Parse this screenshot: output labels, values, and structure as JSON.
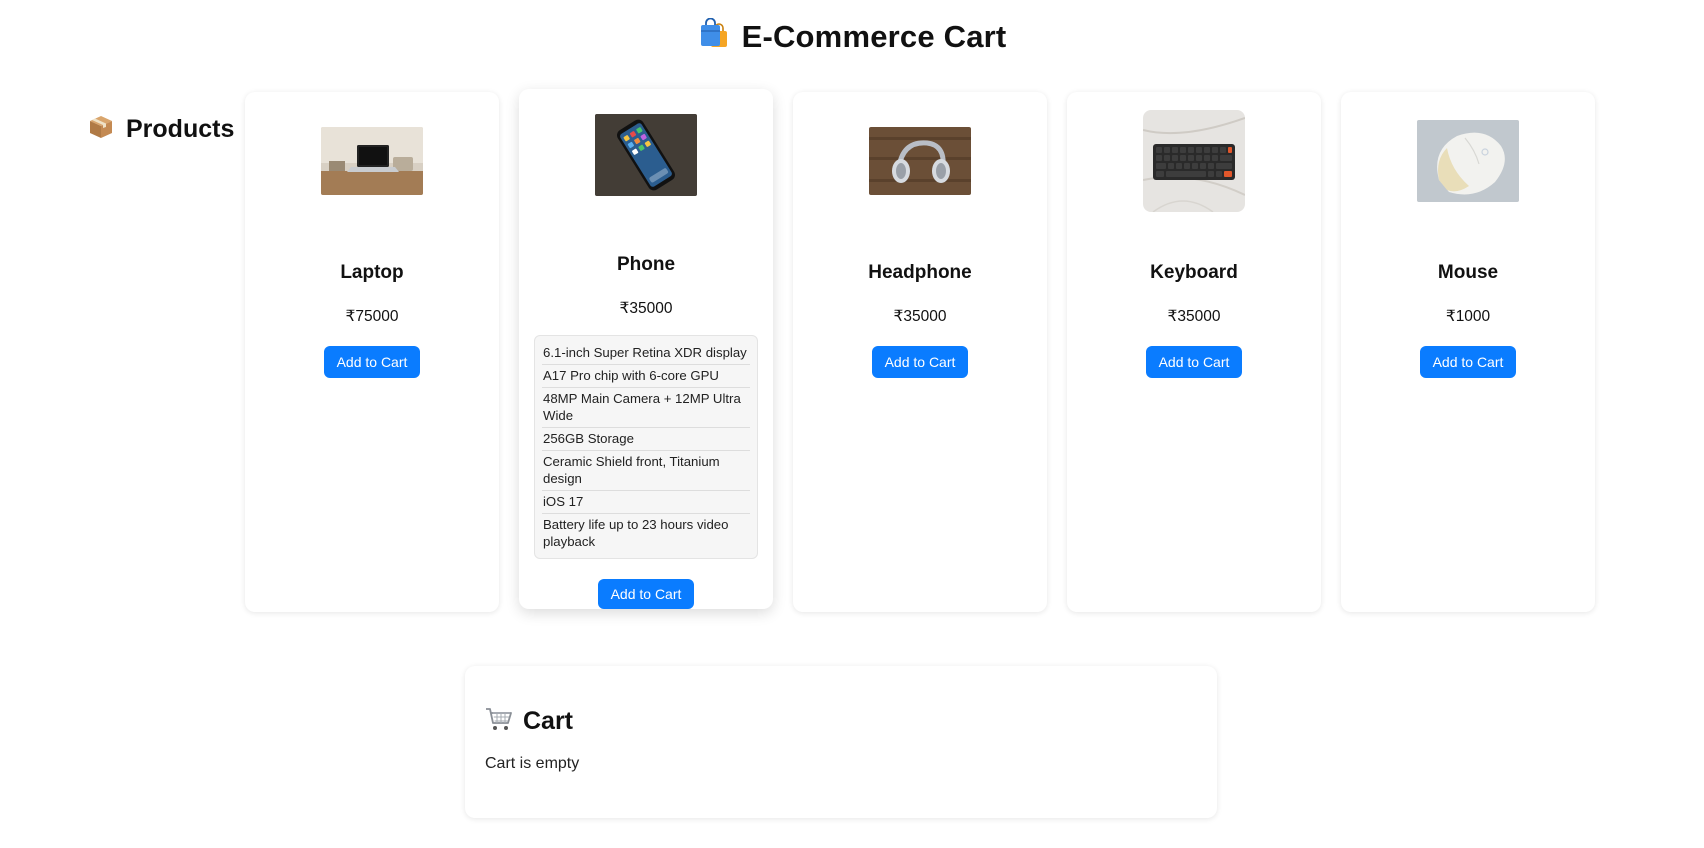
{
  "header": {
    "title": "E-Commerce Cart",
    "icon": "shopping-bags-icon"
  },
  "products_section": {
    "title": "Products",
    "icon": "package-icon"
  },
  "products": [
    {
      "name": "Laptop",
      "price": "₹75000",
      "button": "Add to Cart",
      "image": "laptop-photo",
      "specs": []
    },
    {
      "name": "Phone",
      "price": "₹35000",
      "button": "Add to Cart",
      "image": "phone-photo",
      "specs": [
        "6.1-inch Super Retina XDR display",
        "A17 Pro chip with 6-core GPU",
        "48MP Main Camera + 12MP Ultra Wide",
        "256GB Storage",
        "Ceramic Shield front, Titanium design",
        "iOS 17",
        "Battery life up to 23 hours video playback"
      ]
    },
    {
      "name": "Headphone",
      "price": "₹35000",
      "button": "Add to Cart",
      "image": "headphone-photo",
      "specs": []
    },
    {
      "name": "Keyboard",
      "price": "₹35000",
      "button": "Add to Cart",
      "image": "keyboard-photo",
      "specs": []
    },
    {
      "name": "Mouse",
      "price": "₹1000",
      "button": "Add to Cart",
      "image": "mouse-photo",
      "specs": []
    }
  ],
  "cart": {
    "title": "Cart",
    "icon": "shopping-cart-icon",
    "status": "Cart is empty"
  },
  "colors": {
    "accent": "#0a7cff",
    "card_background": "#ffffff",
    "specs_background": "#f6f6f6"
  }
}
